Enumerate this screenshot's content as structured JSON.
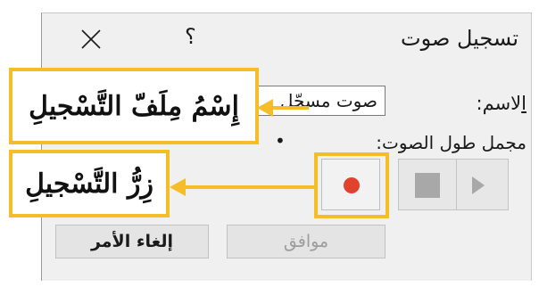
{
  "dialog": {
    "title": "تسجيل صوت",
    "help_label": "؟",
    "close_icon": "close-icon",
    "name_label": "لاسم:",
    "name_label_accel": "ا",
    "name_value": "صوت مسجّل",
    "duration_label": "مجمل طول الصوت:",
    "duration_value": "•",
    "controls": {
      "play_icon": "play-icon",
      "stop_icon": "stop-icon",
      "record_icon": "record-icon"
    },
    "ok_label": "موافق",
    "ok_enabled": false,
    "cancel_label": "إلغاء الأمر"
  },
  "annotations": {
    "name_callout": "إِسْمُ مِلَفّ التَّسْجيلِ",
    "record_callout": "زِرُّ التَّسْجيلِ",
    "highlight_color": "#f5bd27"
  },
  "colors": {
    "record_dot": "#e2412d",
    "dialog_bg": "#f0f0f0",
    "disabled_text": "#9c9c9c"
  }
}
